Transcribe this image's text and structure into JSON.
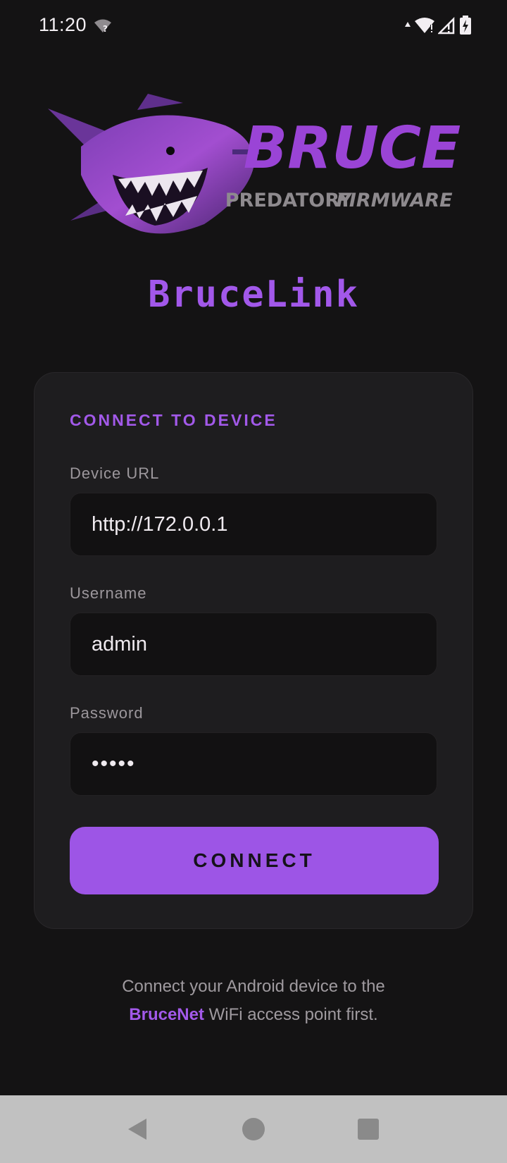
{
  "status_bar": {
    "time": "11:20",
    "icons": [
      "wifi-unknown-icon",
      "data-up-icon",
      "wifi-alert-icon",
      "signal-alert-icon",
      "battery-charging-icon"
    ]
  },
  "logo": {
    "brand": "BRUCE",
    "tagline_1": "PREDATORY",
    "tagline_2": "FIRMWARE"
  },
  "app_title": "BruceLink",
  "form": {
    "heading": "CONNECT TO DEVICE",
    "device_url_label": "Device URL",
    "device_url_value": "http://172.0.0.1",
    "username_label": "Username",
    "username_value": "admin",
    "password_label": "Password",
    "password_value": "•••••",
    "connect_label": "CONNECT"
  },
  "hint": {
    "line1": "Connect your Android device to the",
    "accent": "BruceNet",
    "line2_rest": " WiFi access point first."
  },
  "colors": {
    "background": "#141314",
    "accent": "#a259e9",
    "button": "#9d55e6",
    "card": "#1e1d1f",
    "nav_bar": "#c1c1c1"
  },
  "nav": [
    "back-icon",
    "home-icon",
    "recents-icon"
  ]
}
